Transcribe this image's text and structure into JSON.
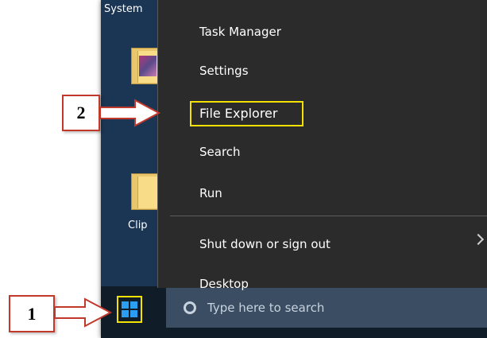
{
  "desktop": {
    "top_label": "System",
    "clip_label": "Clip"
  },
  "menu": {
    "items": [
      {
        "label": "Task Manager"
      },
      {
        "label": "Settings"
      },
      {
        "label": "File Explorer"
      },
      {
        "label": "Search"
      },
      {
        "label": "Run"
      },
      {
        "label": "Shut down or sign out"
      },
      {
        "label": "Desktop"
      }
    ]
  },
  "taskbar": {
    "search_placeholder": "Type here to search"
  },
  "callouts": {
    "step1": "1",
    "step2": "2"
  },
  "colors": {
    "highlight": "#f3e100",
    "callout_border": "#c0392b",
    "menu_bg": "#2b2b2b",
    "desktop_bg": "#1b3554"
  }
}
